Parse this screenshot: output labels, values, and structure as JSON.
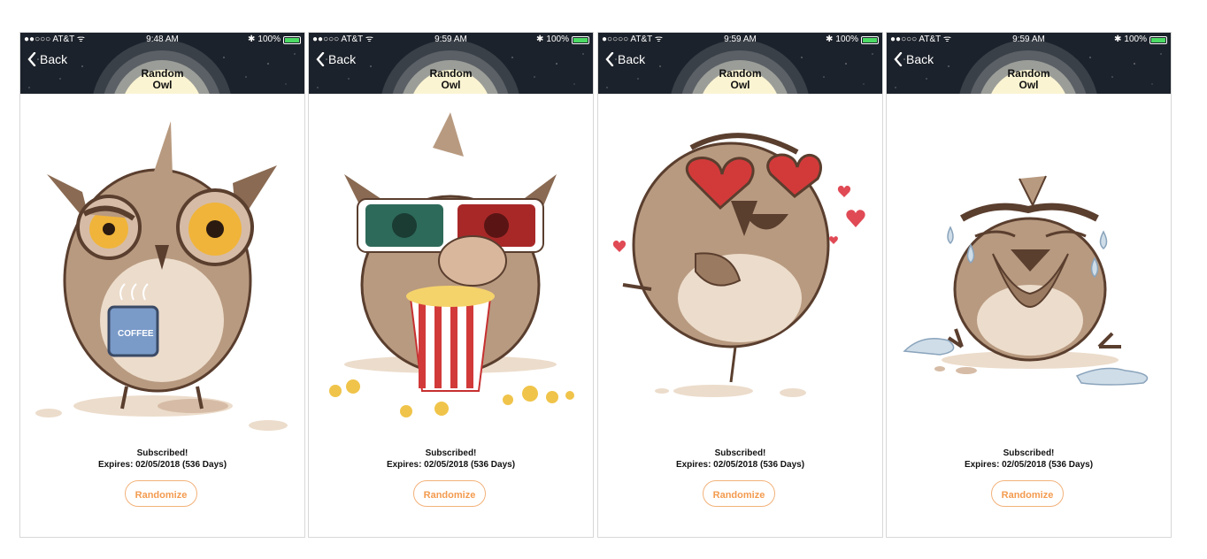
{
  "screens": [
    {
      "status": {
        "carrier": "●●○○○ AT&T ᯤ",
        "time": "9:48 AM",
        "battery": "100%"
      },
      "nav": {
        "back_label": "Back",
        "title_line1": "Random",
        "title_line2": "Owl"
      },
      "subscription": {
        "status": "Subscribed!",
        "expires": "Expires: 02/05/2018 (536 Days)"
      },
      "randomize_label": "Randomize",
      "sticker": "owl-with-coffee"
    },
    {
      "status": {
        "carrier": "●●○○○ AT&T ᯤ",
        "time": "9:59 AM",
        "battery": "100%"
      },
      "nav": {
        "back_label": "Back",
        "title_line1": "Random",
        "title_line2": "Owl"
      },
      "subscription": {
        "status": "Subscribed!",
        "expires": "Expires: 02/05/2018 (536 Days)"
      },
      "randomize_label": "Randomize",
      "sticker": "owl-3d-glasses-popcorn"
    },
    {
      "status": {
        "carrier": "●○○○○ AT&T ᯤ",
        "time": "9:59 AM",
        "battery": "100%"
      },
      "nav": {
        "back_label": "Back",
        "title_line1": "Random",
        "title_line2": "Owl"
      },
      "subscription": {
        "status": "Subscribed!",
        "expires": "Expires: 02/05/2018 (536 Days)"
      },
      "randomize_label": "Randomize",
      "sticker": "owl-heart-eyes"
    },
    {
      "status": {
        "carrier": "●●○○○ AT&T ᯤ",
        "time": "9:59 AM",
        "battery": "100%"
      },
      "nav": {
        "back_label": "Back",
        "title_line1": "Random",
        "title_line2": "Owl"
      },
      "subscription": {
        "status": "Subscribed!",
        "expires": "Expires: 02/05/2018 (536 Days)"
      },
      "randomize_label": "Randomize",
      "sticker": "owl-crying"
    }
  ],
  "colors": {
    "navbar": "#1c222b",
    "accent": "#f39b4f",
    "owl_body": "#b89a80",
    "owl_belly": "#ecdccb",
    "owl_outline": "#5a3e2e"
  }
}
